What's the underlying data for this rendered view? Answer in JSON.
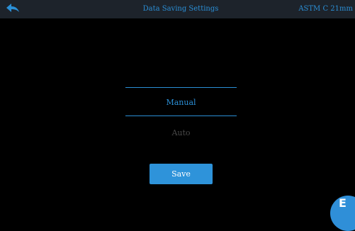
{
  "header": {
    "back_icon": "back-arrow-icon",
    "title": "Data Saving Settings",
    "standard": "ASTM C 21mm"
  },
  "options": [
    {
      "label": "Manual",
      "selected": true
    },
    {
      "label": "Auto",
      "selected": false
    }
  ],
  "save_label": "Save",
  "corner_badge": {
    "label": "E"
  },
  "colors": {
    "accent": "#2b8fd6",
    "header_bg": "#1d232b",
    "background": "#000000",
    "unselected_text": "#4a4a4a",
    "button_bg": "#2e93da"
  }
}
